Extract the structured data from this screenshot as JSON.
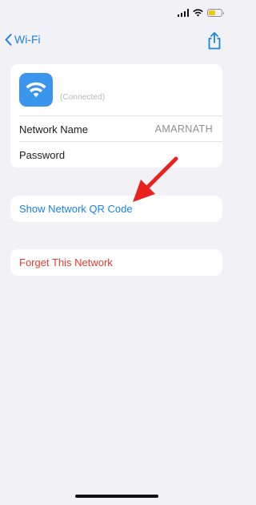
{
  "status_bar": {
    "battery_color": "#f5c400",
    "icons": [
      "signal-icon",
      "wifi-icon",
      "battery-icon"
    ]
  },
  "nav": {
    "back_label": "Wi-Fi",
    "back_icon": "chevron-left-icon",
    "share_icon": "share-icon"
  },
  "network": {
    "icon": "wifi-icon",
    "subtitle": "(Connected)",
    "rows": [
      {
        "label": "Network Name",
        "value": "AMARNATH"
      },
      {
        "label": "Password",
        "value": ""
      }
    ]
  },
  "actions": {
    "qr_label": "Show Network QR Code",
    "forget_label": "Forget This Network"
  },
  "colors": {
    "accent": "#1a82e8",
    "destructive": "#ea3b30",
    "background": "#f2f2f6",
    "annotation_arrow": "#e8221f"
  }
}
